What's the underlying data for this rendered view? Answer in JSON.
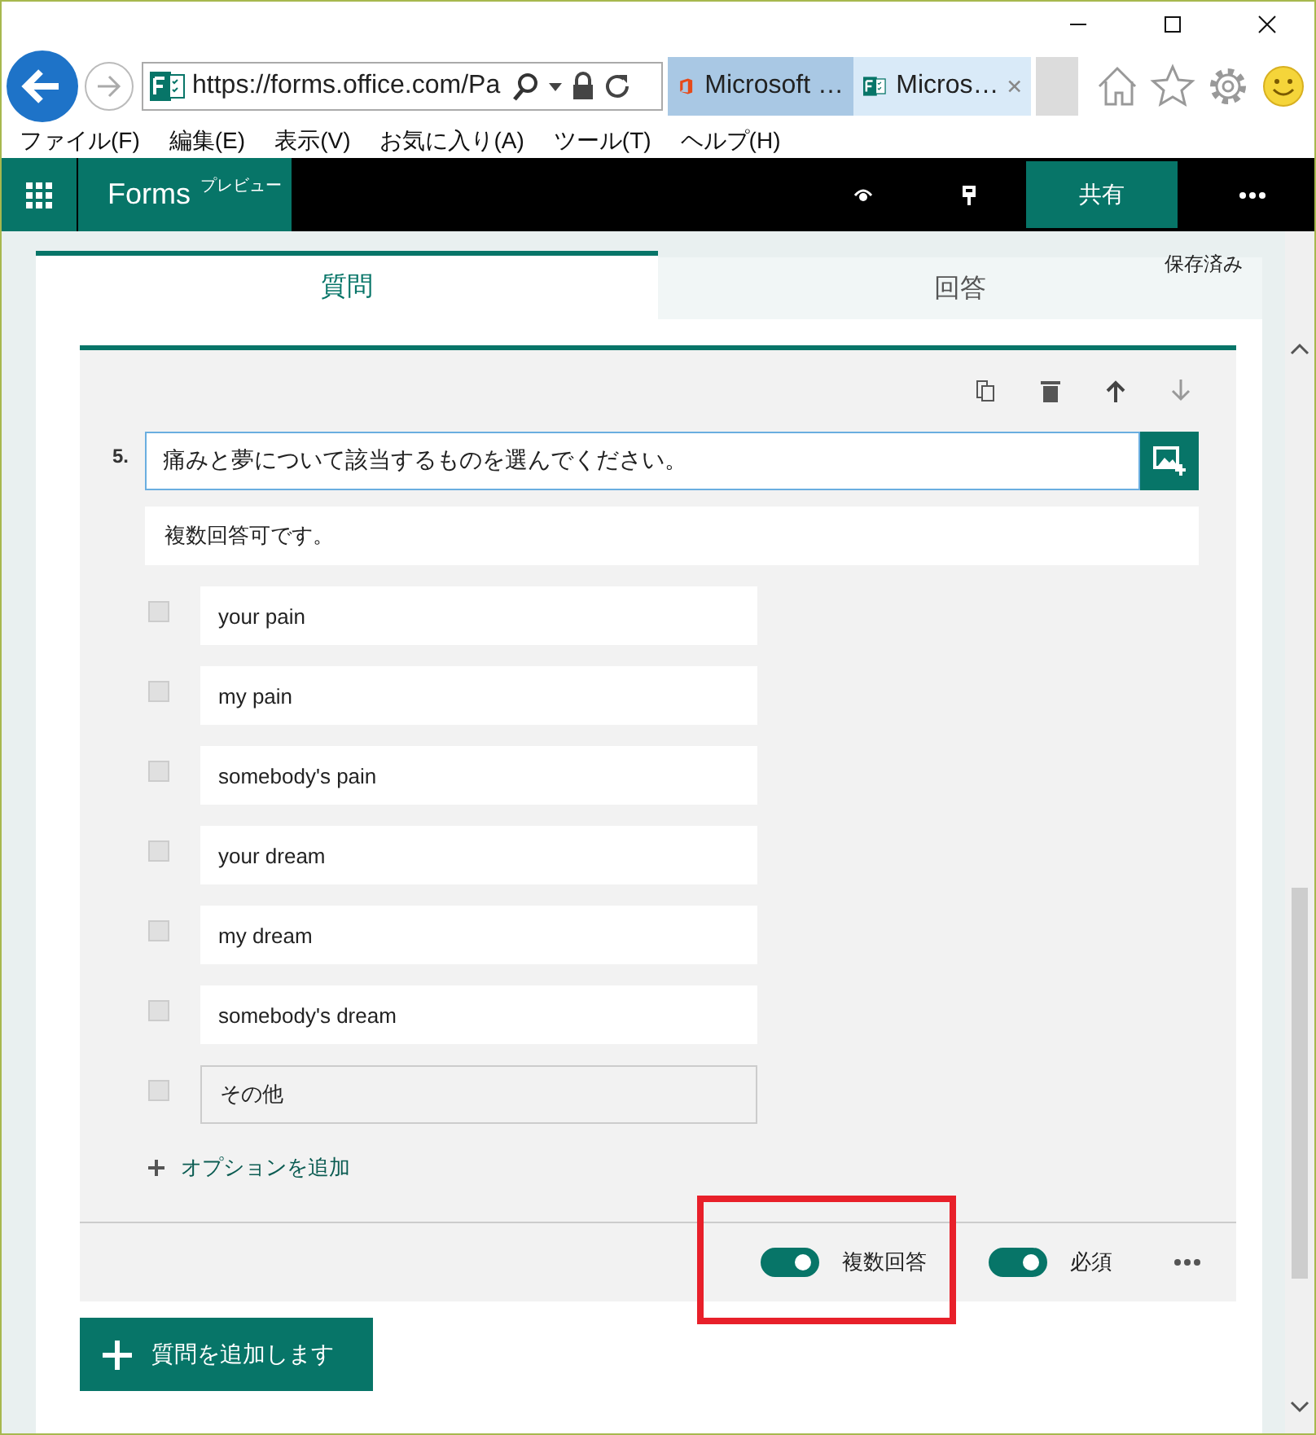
{
  "address_bar": {
    "url": "https://forms.office.com/Pa"
  },
  "browser_tabs": [
    {
      "label": "Microsoft …",
      "selected": false,
      "kind": "office"
    },
    {
      "label": "Micros…",
      "selected": true,
      "kind": "forms"
    }
  ],
  "menu_bar": [
    "ファイル(F)",
    "編集(E)",
    "表示(V)",
    "お気に入り(A)",
    "ツール(T)",
    "ヘルプ(H)"
  ],
  "app_bar": {
    "app": "Forms",
    "badge": "プレビュー",
    "share": "共有"
  },
  "form_tabs": [
    {
      "label": "質問",
      "selected": true
    },
    {
      "label": "回答",
      "selected": false
    }
  ],
  "save_status": "保存済み",
  "question": {
    "number": "5.",
    "title": "痛みと夢について該当するものを選んでください。",
    "subtitle": "複数回答可です。",
    "options": [
      {
        "label": "your pain",
        "checked": false,
        "kind": "choice"
      },
      {
        "label": "my pain",
        "checked": false,
        "kind": "choice"
      },
      {
        "label": "somebody's pain",
        "checked": false,
        "kind": "choice"
      },
      {
        "label": "your dream",
        "checked": false,
        "kind": "choice"
      },
      {
        "label": "my dream",
        "checked": false,
        "kind": "choice"
      },
      {
        "label": "somebody's dream",
        "checked": false,
        "kind": "choice"
      },
      {
        "label": "その他",
        "checked": false,
        "kind": "other"
      }
    ],
    "add_option": "オプションを追加",
    "toggles": [
      {
        "label": "複数回答",
        "on": true
      },
      {
        "label": "必須",
        "on": true
      }
    ]
  },
  "add_question": "質問を追加します"
}
